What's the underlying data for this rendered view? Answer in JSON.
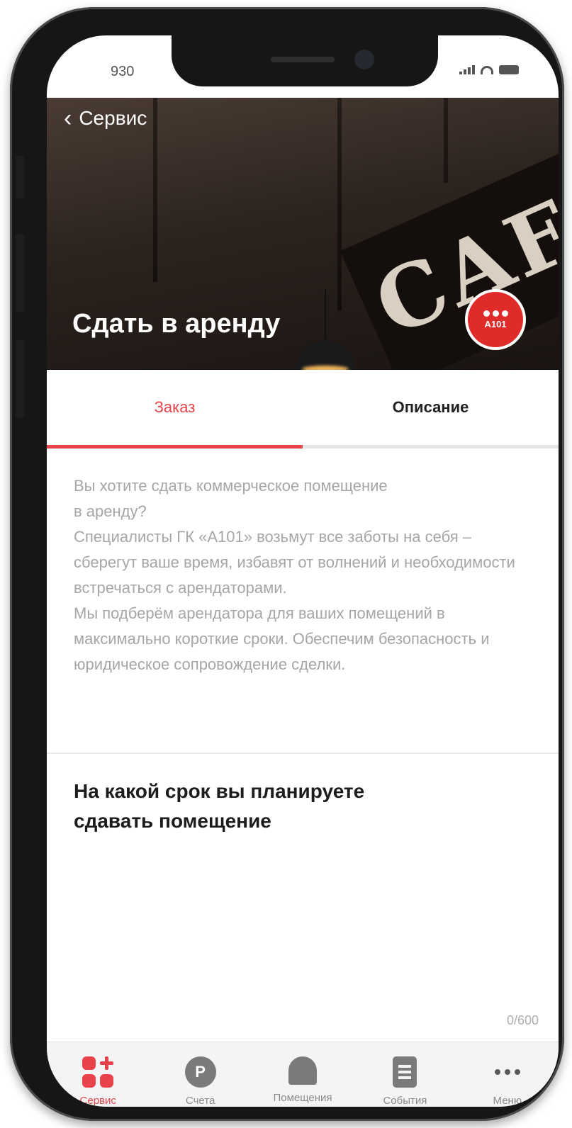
{
  "status_bar": {
    "time": "930"
  },
  "hero": {
    "back_label": "Сервис",
    "title": "Сдать в аренду",
    "sign_text": "CAFE",
    "brand_logo_text": "A101"
  },
  "tabs": [
    {
      "label": "Заказ",
      "active": true
    },
    {
      "label": "Описание",
      "active": false
    }
  ],
  "description": "Вы хотите сдать коммерческое помещение\nв аренду?\nСпециалисты ГК «А101» возьмут все заботы на себя – сберегут ваше время, избавят от волнений и необходимости встречаться с арендаторами.\nМы подберём арендатора для ваших помещений в максимально короткие сроки. Обеспечим безопасность и юридическое сопровождение сделки.",
  "question": "На какой срок вы планируете сдавать помещение",
  "char_counter": "0/600",
  "tab_bar": [
    {
      "label": "Сервис",
      "icon": "service-grid-icon",
      "active": true
    },
    {
      "label": "Счета",
      "icon": "ruble-coin-icon",
      "active": false
    },
    {
      "label": "Помещения",
      "icon": "building-icon",
      "active": false
    },
    {
      "label": "События",
      "icon": "document-list-icon",
      "active": false
    },
    {
      "label": "Меню",
      "icon": "more-dots-icon",
      "active": false
    }
  ],
  "colors": {
    "accent": "#e8434b",
    "brand_red": "#e02b2b",
    "muted_text": "#a6a6a6"
  }
}
